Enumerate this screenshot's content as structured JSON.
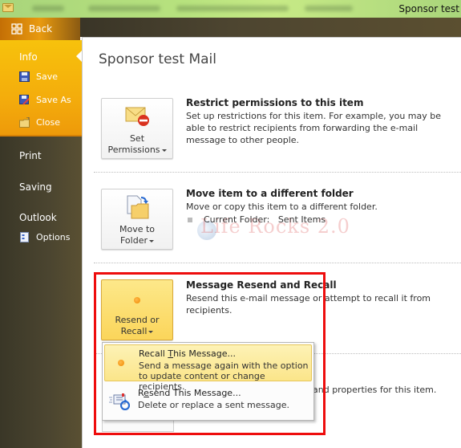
{
  "titlebar": {
    "window_title": "Sponsor test",
    "app_icon": "mail-envelope-icon"
  },
  "backstage": {
    "back_label": "Back",
    "back_icon": "back-grid-icon"
  },
  "leftnav": {
    "info_label": "Info",
    "info_items": [
      {
        "label": "Save",
        "icon": "floppy-disk-icon"
      },
      {
        "label": "Save As",
        "icon": "save-as-icon"
      },
      {
        "label": "Close",
        "icon": "folder-close-icon"
      }
    ],
    "print_label": "Print",
    "saving_label": "Saving",
    "outlook_label": "Outlook",
    "options_label": "Options"
  },
  "main": {
    "page_title": "Sponsor test Mail",
    "sections": [
      {
        "button_line1": "Set",
        "button_line2": "Permissions",
        "button_icon": "envelope-restrict-icon",
        "title": "Restrict permissions to this item",
        "description": "Set up restrictions for this item. For example, you may be able to restrict recipients from forwarding the e-mail message to other people."
      },
      {
        "button_line1": "Move to",
        "button_line2": "Folder",
        "button_icon": "move-to-folder-icon",
        "title": "Move item to a different folder",
        "description": "Move or copy this item to a different folder.",
        "current_folder_label": "Current Folder:",
        "current_folder_value": "Sent Items"
      },
      {
        "button_line1": "Resend or",
        "button_line2": "Recall",
        "button_icon": "orange-dot-icon",
        "title": "Message Resend and Recall",
        "description": "Resend this e-mail message or attempt to recall it from recipients."
      }
    ],
    "partial_section_text": "and properties for this item.",
    "watermark": "Life Rocks 2.0"
  },
  "dropdown_menu": {
    "items": [
      {
        "title_pre": "Recall ",
        "title_accel": "T",
        "title_post": "his Message...",
        "description_line1": "Send a message again with the option",
        "description_line2": "to update content or change recipients.",
        "icon": "orange-dot-icon",
        "highlighted": true
      },
      {
        "title_pre": "R",
        "title_accel": "e",
        "title_post": "send This Message...",
        "description_line1": "Delete or replace a sent message.",
        "icon": "resend-message-icon",
        "highlighted": false
      }
    ]
  },
  "colors": {
    "backstage_accent": "#f4ad0c",
    "highlight_box": "#ee0d0d",
    "menu_hover": "#fbe58a"
  }
}
